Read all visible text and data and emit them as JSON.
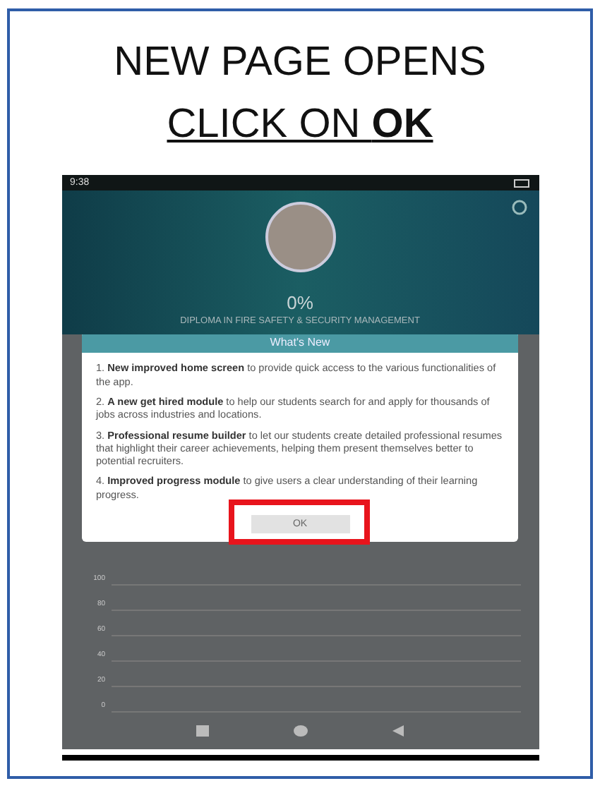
{
  "title": {
    "text": "NEW PAGE OPENS",
    "underlined": "CLICK ON **OK**"
  },
  "phone": {
    "status_bar": {
      "time": "9:38"
    },
    "profile": {
      "progress": "0%",
      "course": "DIPLOMA IN FIRE SAFETY & SECURITY MANAGEMENT"
    },
    "dialog": {
      "title": "What's New",
      "items": [
        "1. **New improved home screen** to provide quick access to the various functionalities of the app.",
        "2. **A new get hired module** to help our students search for and apply for thousands of jobs across industries and locations.",
        "3. **Professional resume builder** to let our students create detailed professional resumes that highlight their career achievements, helping them present themselves better to potential recruiters.",
        "4. **Improved progress module** to give users a clear understanding of their learning progress."
      ],
      "button": "OK",
      "highlighted": true
    },
    "chart": {
      "y_labels": [
        "100",
        "80",
        "60",
        "40",
        "20",
        "0"
      ]
    }
  }
}
